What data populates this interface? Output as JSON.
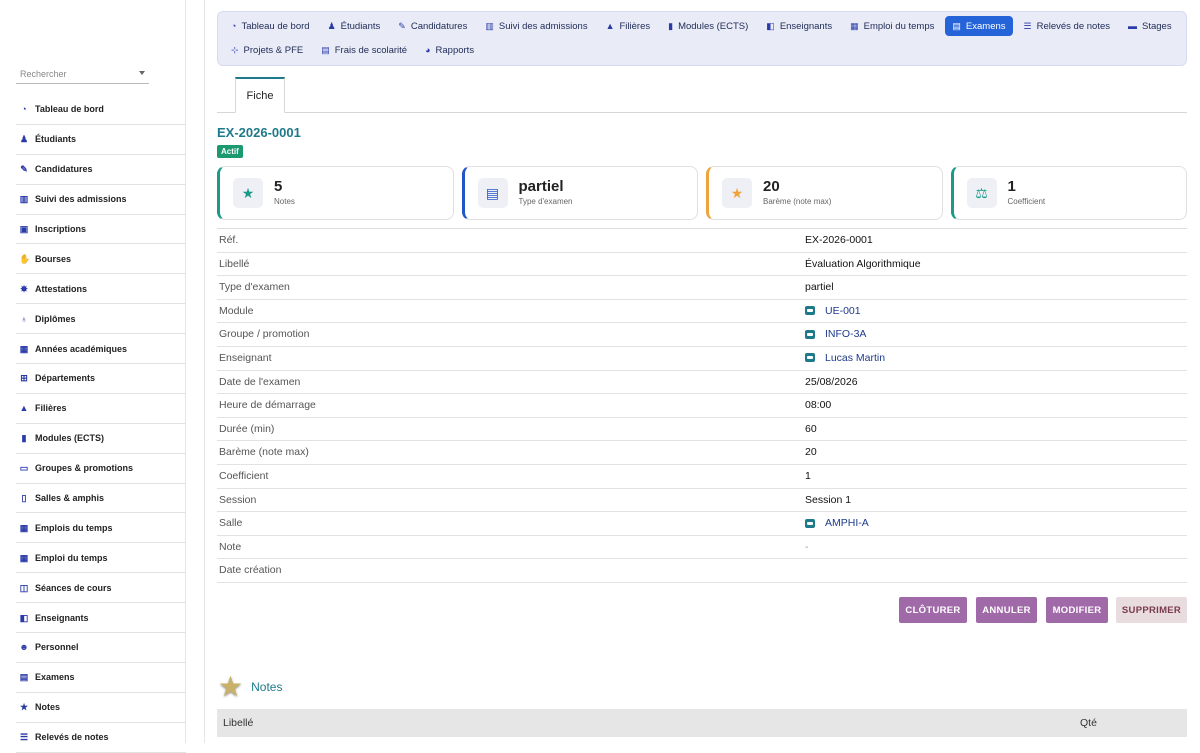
{
  "sidebar": {
    "search_placeholder": "Rechercher",
    "items": [
      {
        "label": "Tableau de bord",
        "icon": "gauge-icon"
      },
      {
        "label": "Étudiants",
        "icon": "student-icon"
      },
      {
        "label": "Candidatures",
        "icon": "file-signature-icon"
      },
      {
        "label": "Suivi des admissions",
        "icon": "columns-icon"
      },
      {
        "label": "Inscriptions",
        "icon": "clipboard-check-icon"
      },
      {
        "label": "Bourses",
        "icon": "hand-coin-icon"
      },
      {
        "label": "Attestations",
        "icon": "certificate-icon"
      },
      {
        "label": "Diplômes",
        "icon": "award-icon"
      },
      {
        "label": "Années académiques",
        "icon": "calendar-icon"
      },
      {
        "label": "Départements",
        "icon": "sitemap-icon"
      },
      {
        "label": "Filières",
        "icon": "graduation-cap-icon"
      },
      {
        "label": "Modules (ECTS)",
        "icon": "book-icon"
      },
      {
        "label": "Groupes & promotions",
        "icon": "screen-icon"
      },
      {
        "label": "Salles & amphis",
        "icon": "door-icon"
      },
      {
        "label": "Emplois du temps",
        "icon": "calendar-icon"
      },
      {
        "label": "Emploi du temps",
        "icon": "calendar-icon"
      },
      {
        "label": "Séances de cours",
        "icon": "book-open-icon"
      },
      {
        "label": "Enseignants",
        "icon": "teacher-icon"
      },
      {
        "label": "Personnel",
        "icon": "users-icon"
      },
      {
        "label": "Examens",
        "icon": "file-icon"
      },
      {
        "label": "Notes",
        "icon": "star-icon"
      },
      {
        "label": "Relevés de notes",
        "icon": "file-lines-icon"
      }
    ]
  },
  "topnav": {
    "row1": [
      {
        "label": "Tableau de bord",
        "icon": "gauge-icon",
        "active": false
      },
      {
        "label": "Étudiants",
        "icon": "student-icon",
        "active": false
      },
      {
        "label": "Candidatures",
        "icon": "file-signature-icon",
        "active": false
      },
      {
        "label": "Suivi des admissions",
        "icon": "columns-icon",
        "active": false
      },
      {
        "label": "Filières",
        "icon": "graduation-cap-icon",
        "active": false
      },
      {
        "label": "Modules (ECTS)",
        "icon": "book-icon",
        "active": false
      },
      {
        "label": "Enseignants",
        "icon": "teacher-icon",
        "active": false
      },
      {
        "label": "Emploi du temps",
        "icon": "calendar-icon",
        "active": false
      },
      {
        "label": "Examens",
        "icon": "file-icon",
        "active": true
      },
      {
        "label": "Relevés de notes",
        "icon": "file-lines-icon",
        "active": false
      },
      {
        "label": "Stages",
        "icon": "briefcase-icon",
        "active": false
      }
    ],
    "row2": [
      {
        "label": "Projets & PFE",
        "icon": "project-diagram-icon",
        "active": false
      },
      {
        "label": "Frais de scolarité",
        "icon": "receipt-icon",
        "active": false
      },
      {
        "label": "Rapports",
        "icon": "pie-chart-icon",
        "active": false
      }
    ]
  },
  "tabs": {
    "fiche": "Fiche"
  },
  "record": {
    "ref": "EX-2026-0001",
    "status": "Actif"
  },
  "cards": [
    {
      "value": "5",
      "label": "Notes",
      "icon": "star-icon",
      "accent": "#1b9a8a"
    },
    {
      "value": "partiel",
      "label": "Type d'examen",
      "icon": "file-icon",
      "accent": "#2256c8"
    },
    {
      "value": "20",
      "label": "Barème (note max)",
      "icon": "star-icon",
      "accent": "#f0a33a"
    },
    {
      "value": "1",
      "label": "Coefficient",
      "icon": "balance-scale-icon",
      "accent": "#1b9a8a"
    }
  ],
  "details": [
    {
      "key": "Réf.",
      "value": "EX-2026-0001",
      "link": false
    },
    {
      "key": "Libellé",
      "value": "Évaluation Algorithmique",
      "link": false
    },
    {
      "key": "Type d'examen",
      "value": "partiel",
      "link": false
    },
    {
      "key": "Module",
      "value": "UE-001",
      "link": true
    },
    {
      "key": "Groupe / promotion",
      "value": "INFO-3A",
      "link": true
    },
    {
      "key": "Enseignant",
      "value": "Lucas Martin",
      "link": true
    },
    {
      "key": "Date de l'examen",
      "value": "25/08/2026",
      "link": false
    },
    {
      "key": "Heure de démarrage",
      "value": "08:00",
      "link": false
    },
    {
      "key": "Durée (min)",
      "value": "60",
      "link": false
    },
    {
      "key": "Barème (note max)",
      "value": "20",
      "link": false
    },
    {
      "key": "Coefficient",
      "value": "1",
      "link": false
    },
    {
      "key": "Session",
      "value": "Session 1",
      "link": false
    },
    {
      "key": "Salle",
      "value": "AMPHI-A",
      "link": true
    },
    {
      "key": "Note",
      "value": "-",
      "link": false,
      "muted": true
    },
    {
      "key": "Date création",
      "value": "",
      "link": false
    }
  ],
  "actions": {
    "cloturer": "CLÔTURER",
    "annuler": "ANNULER",
    "modifier": "MODIFIER",
    "supprimer": "SUPPRIMER"
  },
  "notes_section": {
    "title": "Notes",
    "col_libelle": "Libellé",
    "col_qte": "Qté"
  },
  "colors": {
    "accent": "#1e7a8a",
    "active_nav": "#2563d9",
    "action": "#a06aa8"
  }
}
